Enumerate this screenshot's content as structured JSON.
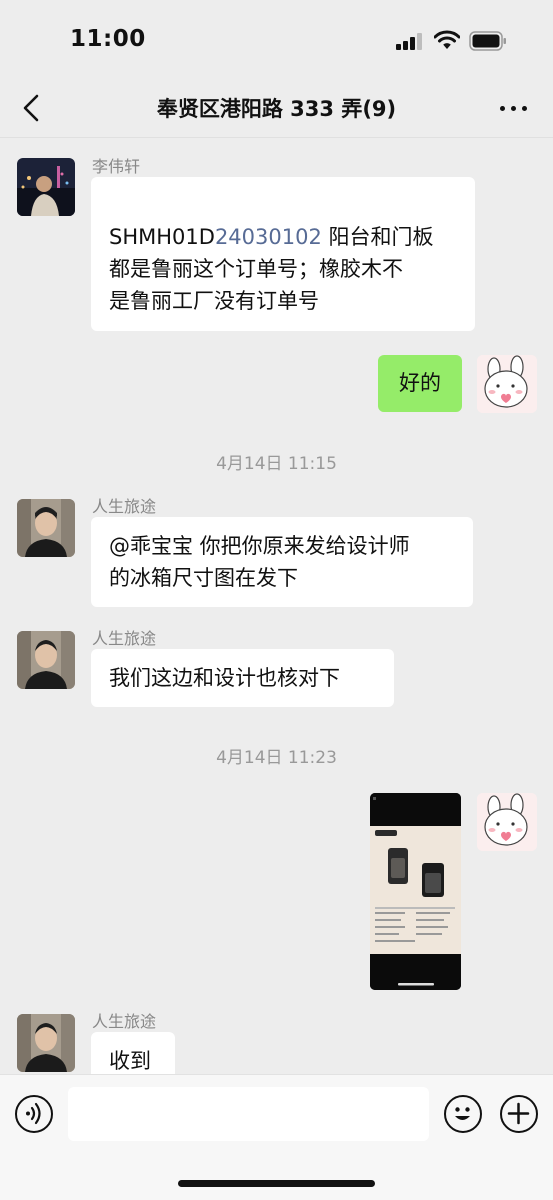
{
  "status_bar": {
    "time": "11:00"
  },
  "nav": {
    "title": "奉贤区港阳路 333 弄(9)"
  },
  "messages": [
    {
      "sender": "李伟轩",
      "text_prefix": "SHMH01D",
      "text_number": "24030102",
      "text_line1_rest": " 阳台和门板",
      "text_line2": "都是鲁丽这个订单号；橡胶木不",
      "text_line3": "是鲁丽工厂没有订单号"
    },
    {
      "text": "好的"
    },
    {
      "timestamp": "4月14日 11:15"
    },
    {
      "sender": "人生旅途",
      "text_line1": "@乖宝宝 你把你原来发给设计师",
      "text_line2": "的冰箱尺寸图在发下"
    },
    {
      "sender": "人生旅途",
      "text": "我们这边和设计也核对下"
    },
    {
      "timestamp": "4月14日 11:23"
    },
    {
      "sender": "人生旅途",
      "text": "收到"
    }
  ],
  "colors": {
    "accent_green": "#95ec69",
    "link_blue": "#576b95",
    "background": "#ededed"
  },
  "input": {
    "placeholder": ""
  }
}
